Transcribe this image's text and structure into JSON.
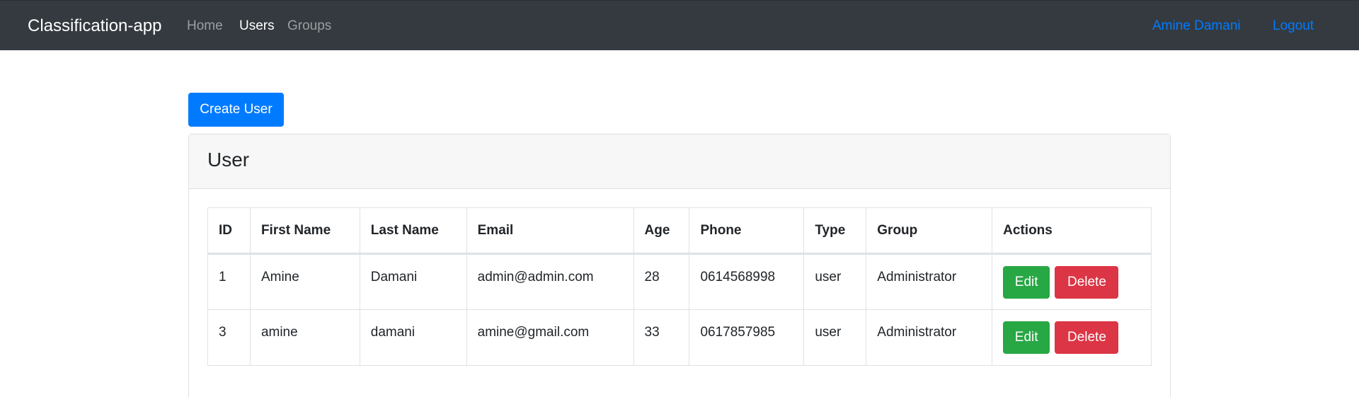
{
  "navbar": {
    "brand": "Classification-app",
    "links": [
      {
        "label": "Home",
        "active": false
      },
      {
        "label": "Users",
        "active": true
      },
      {
        "label": "Groups",
        "active": false
      }
    ],
    "user_name": "Amine Damani",
    "logout": "Logout"
  },
  "actions": {
    "create_user": "Create User"
  },
  "card": {
    "title": "User"
  },
  "table": {
    "columns": [
      "ID",
      "First Name",
      "Last Name",
      "Email",
      "Age",
      "Phone",
      "Type",
      "Group",
      "Actions"
    ],
    "rows": [
      {
        "id": "1",
        "first_name": "Amine",
        "last_name": "Damani",
        "email": "admin@admin.com",
        "age": "28",
        "phone": "0614568998",
        "type": "user",
        "group": "Administrator",
        "edit": "Edit",
        "delete": "Delete"
      },
      {
        "id": "3",
        "first_name": "amine",
        "last_name": "damani",
        "email": "amine@gmail.com",
        "age": "33",
        "phone": "0617857985",
        "type": "user",
        "group": "Administrator",
        "edit": "Edit",
        "delete": "Delete"
      }
    ]
  },
  "colors": {
    "navbar_bg": "#343a40",
    "primary": "#007bff",
    "success": "#28a745",
    "danger": "#dc3545"
  }
}
